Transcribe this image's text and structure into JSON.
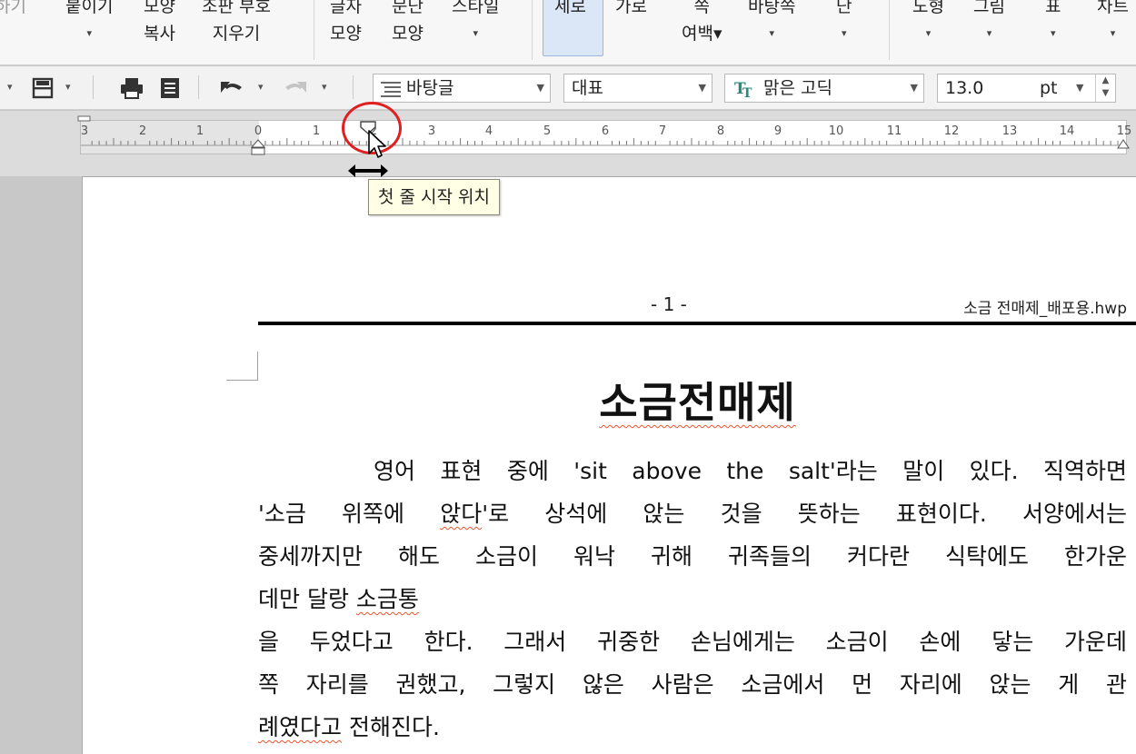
{
  "ribbon": {
    "items": [
      {
        "line1": "하기",
        "line2": ""
      },
      {
        "line1": "붙이기",
        "line2": "▾"
      },
      {
        "line1": "모양",
        "line2": "복사"
      },
      {
        "line1": "조판 부호",
        "line2": "지우기"
      },
      {
        "line1": "글자",
        "line2": "모양"
      },
      {
        "line1": "문단",
        "line2": "모양"
      },
      {
        "line1": "스타일",
        "line2": "▾"
      },
      {
        "line1": "세로",
        "line2": ""
      },
      {
        "line1": "가로",
        "line2": ""
      },
      {
        "line1": "쪽",
        "line2": "여백▾"
      },
      {
        "line1": "바탕쪽",
        "line2": "▾"
      },
      {
        "line1": "단",
        "line2": "▾"
      },
      {
        "line1": "도형",
        "line2": "▾"
      },
      {
        "line1": "그림",
        "line2": "▾"
      },
      {
        "line1": "표",
        "line2": "▾"
      },
      {
        "line1": "차트",
        "line2": "▾"
      }
    ]
  },
  "toolbar": {
    "style_combo": "바탕글",
    "language_combo": "대표",
    "font_combo": "맑은 고딕",
    "font_size": "13.0",
    "font_unit": "pt",
    "icons": [
      "save-icon",
      "print-icon",
      "preview-icon",
      "undo-icon",
      "redo-icon",
      "paragraph-style-icon",
      "truetype-font-icon"
    ]
  },
  "ruler": {
    "numbers": [
      "3",
      "2",
      "1",
      "0",
      "1",
      "2",
      "3",
      "4",
      "5",
      "6",
      "7",
      "8",
      "9",
      "10",
      "11",
      "12",
      "13",
      "14",
      "15"
    ]
  },
  "tooltip": {
    "text": "첫 줄 시작 위치"
  },
  "document": {
    "header_page_number": "- 1 -",
    "header_filename": "소금 전매제_배포용.hwp",
    "title": "소금전매제",
    "lines": [
      "영어 표현 중에 'sit above the salt'라는 말이 있다. 직역하면",
      "'소금 위쪽에 앉다'로 상석에 앉는 것을 뜻하는 표현이다. 서양에서는",
      "중세까지만 해도 소금이 워낙 귀해 귀족들의 커다란 식탁에도 한가운",
      "데만 달랑 소금통",
      "을 두었다고 한다. 그래서 귀중한 손님에게는 소금이 손에 닿는 가운데",
      "쪽 자리를 권했고, 그렇지 않은 사람은 소금에서 먼 자리에 앉는 게 관",
      "례였다고 전해진다."
    ]
  },
  "colors": {
    "accent_selected": "#dbe6f7",
    "highlight_circle": "#e02020",
    "spellcheck_underline": "#e8562b",
    "tooltip_bg": "#ffffe6"
  }
}
